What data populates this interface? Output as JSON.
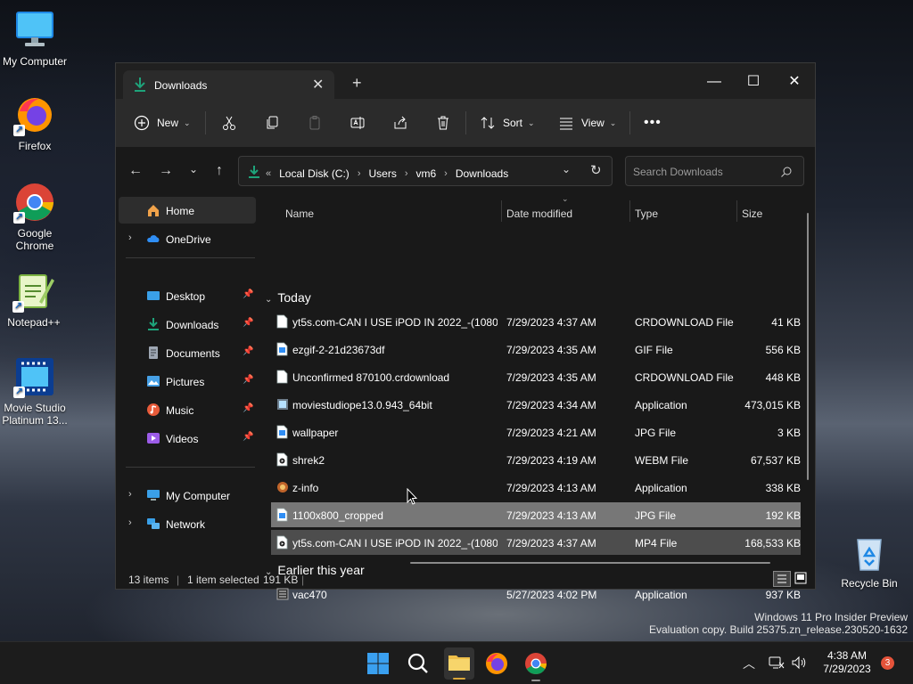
{
  "desktop": {
    "icons": [
      {
        "label": "My Computer"
      },
      {
        "label": "Firefox"
      },
      {
        "label": "Google Chrome"
      },
      {
        "label": "Notepad++"
      },
      {
        "label": "Movie Studio Platinum 13..."
      },
      {
        "label": "Recycle Bin"
      }
    ],
    "watermark": {
      "line1": "Windows 11 Pro Insider Preview",
      "line2": "Evaluation copy. Build 25375.zn_release.230520-1632"
    }
  },
  "window": {
    "tab_title": "Downloads",
    "toolbar": {
      "new_label": "New",
      "sort_label": "Sort",
      "view_label": "View"
    },
    "address": {
      "crumbs": [
        "Local Disk (C:)",
        "Users",
        "vm6",
        "Downloads"
      ]
    },
    "search": {
      "placeholder": "Search Downloads"
    },
    "nav": {
      "home": "Home",
      "onedrive": "OneDrive",
      "quick": [
        "Desktop",
        "Downloads",
        "Documents",
        "Pictures",
        "Music",
        "Videos"
      ],
      "my_computer": "My Computer",
      "network": "Network"
    },
    "columns": {
      "name": "Name",
      "date": "Date modified",
      "type": "Type",
      "size": "Size"
    },
    "groups": {
      "today": {
        "label": "Today",
        "files": [
          {
            "name": "yt5s.com-CAN I USE iPOD IN 2022_-(1080...",
            "date": "7/29/2023 4:37 AM",
            "type": "CRDOWNLOAD File",
            "size": "41 KB"
          },
          {
            "name": "ezgif-2-21d23673df",
            "date": "7/29/2023 4:35 AM",
            "type": "GIF File",
            "size": "556 KB"
          },
          {
            "name": "Unconfirmed 870100.crdownload",
            "date": "7/29/2023 4:35 AM",
            "type": "CRDOWNLOAD File",
            "size": "448 KB"
          },
          {
            "name": "moviestudiope13.0.943_64bit",
            "date": "7/29/2023 4:34 AM",
            "type": "Application",
            "size": "473,015 KB"
          },
          {
            "name": "wallpaper",
            "date": "7/29/2023 4:21 AM",
            "type": "JPG File",
            "size": "3 KB"
          },
          {
            "name": "shrek2",
            "date": "7/29/2023 4:19 AM",
            "type": "WEBM File",
            "size": "67,537 KB"
          },
          {
            "name": "z-info",
            "date": "7/29/2023 4:13 AM",
            "type": "Application",
            "size": "338 KB"
          },
          {
            "name": "1100x800_cropped",
            "date": "7/29/2023 4:13 AM",
            "type": "JPG File",
            "size": "192 KB"
          },
          {
            "name": "yt5s.com-CAN I USE iPOD IN 2022_-(1080...",
            "date": "7/29/2023 4:37 AM",
            "type": "MP4 File",
            "size": "168,533 KB"
          }
        ]
      },
      "earlier": {
        "label": "Earlier this year",
        "files": [
          {
            "name": "vac470",
            "date": "5/27/2023 4:02 PM",
            "type": "Application",
            "size": "937 KB"
          }
        ]
      }
    },
    "status": {
      "items": "13 items",
      "selected": "1 item selected",
      "size": "191 KB"
    }
  },
  "taskbar": {
    "time": "4:38 AM",
    "date": "7/29/2023",
    "notification_count": "3"
  },
  "colors": {
    "accent": "#1ea37a",
    "folder": "#f0c04a",
    "selection": "#777777"
  }
}
